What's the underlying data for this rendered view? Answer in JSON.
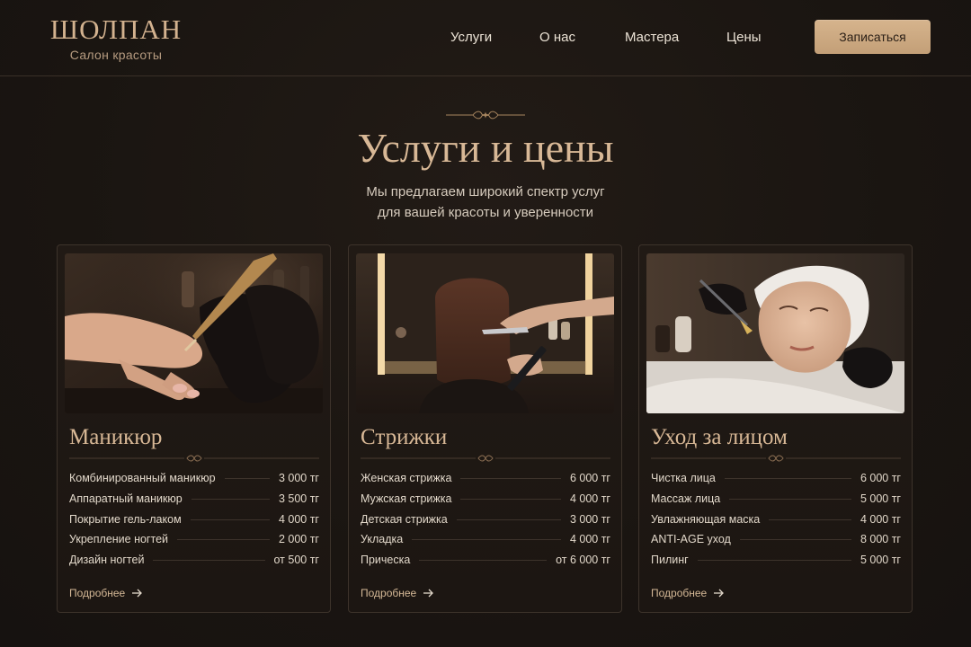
{
  "brand": {
    "name": "ШОЛПАН",
    "tagline": "Салон красоты"
  },
  "nav": {
    "items": [
      "Услуги",
      "О нас",
      "Мастера",
      "Цены"
    ],
    "cta_label": "Записаться"
  },
  "hero": {
    "title": "Услуги и цены",
    "subtitle_line1": "Мы предлагаем широкий спектр услуг",
    "subtitle_line2": "для вашей красоты и уверенности"
  },
  "colors": {
    "accent": "#d8b896",
    "button": "#cfae88",
    "background": "#1b1612"
  },
  "cards": [
    {
      "title": "Маникюр",
      "image_icon": "manicure-photo",
      "items": [
        {
          "name": "Комбинированный маникюр",
          "price": "3 000 тг"
        },
        {
          "name": "Аппаратный маникюр",
          "price": "3 500 тг"
        },
        {
          "name": "Покрытие гель-лаком",
          "price": "4 000 тг"
        },
        {
          "name": "Укрепление ногтей",
          "price": "2 000 тг"
        },
        {
          "name": "Дизайн ногтей",
          "price": "от 500 тг"
        }
      ],
      "more_label": "Подробнее"
    },
    {
      "title": "Стрижки",
      "image_icon": "haircut-photo",
      "items": [
        {
          "name": "Женская стрижка",
          "price": "6 000 тг"
        },
        {
          "name": "Мужская стрижка",
          "price": "4 000 тг"
        },
        {
          "name": "Детская стрижка",
          "price": "3 000 тг"
        },
        {
          "name": "Укладка",
          "price": "4 000 тг"
        },
        {
          "name": "Прическа",
          "price": "от 6 000 тг"
        }
      ],
      "more_label": "Подробнее"
    },
    {
      "title": "Уход за лицом",
      "image_icon": "facial-care-photo",
      "items": [
        {
          "name": "Чистка лица",
          "price": "6 000 тг"
        },
        {
          "name": "Массаж лица",
          "price": "5 000 тг"
        },
        {
          "name": "Увлажняющая маска",
          "price": "4 000 тг"
        },
        {
          "name": "ANTI-AGE уход",
          "price": "8 000 тг"
        },
        {
          "name": "Пилинг",
          "price": "5 000 тг"
        }
      ],
      "more_label": "Подробнее"
    }
  ]
}
